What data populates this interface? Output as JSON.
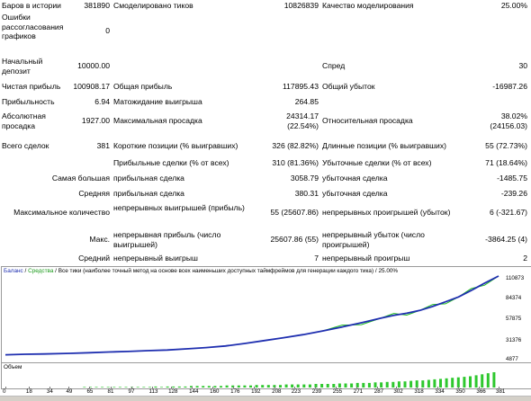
{
  "report": {
    "bars_label": "Баров в истории",
    "bars_value": "381890",
    "ticks_label": "Смоделировано тиков",
    "ticks_value": "10826839",
    "quality_label": "Качество моделирования",
    "quality_value": "25.00%",
    "mismatch_label": "Ошибки рассогласования графиков",
    "mismatch_value": "0",
    "deposit_label": "Начальный депозит",
    "deposit_value": "10000.00",
    "spread_label": "Спред",
    "spread_value": "30",
    "net_label": "Чистая прибыль",
    "net_value": "100908.17",
    "gross_profit_label": "Общая прибыль",
    "gross_profit_value": "117895.43",
    "gross_loss_label": "Общий убыток",
    "gross_loss_value": "-16987.26",
    "pf_label": "Прибыльность",
    "pf_value": "6.94",
    "expected_label": "Матожидание выигрыша",
    "expected_value": "264.85",
    "abs_dd_label": "Абсолютная просадка",
    "abs_dd_value": "1927.00",
    "max_dd_label": "Максимальная просадка",
    "max_dd_value": "24314.17\n(22.54%)",
    "rel_dd_label": "Относительная просадка",
    "rel_dd_value": "38.02%\n(24156.03)",
    "total_label": "Всего сделок",
    "total_value": "381",
    "short_label": "Короткие позиции (% выигравших)",
    "short_value": "326 (82.82%)",
    "long_label": "Длинные позиции (% выигравших)",
    "long_value": "55 (72.73%)",
    "profit_trades_label": "Прибыльные сделки (% от всех)",
    "profit_trades_value": "310 (81.36%)",
    "loss_trades_label": "Убыточные сделки (% от всех)",
    "loss_trades_value": "71 (18.64%)",
    "largest_label": "Самая большая",
    "largest_profit_label": "прибыльная сделка",
    "largest_profit_value": "3058.79",
    "largest_loss_label": "убыточная сделка",
    "largest_loss_value": "-1485.75",
    "average_label": "Средняя",
    "average_profit_label": "прибыльная сделка",
    "average_profit_value": "380.31",
    "average_loss_label": "убыточная сделка",
    "average_loss_value": "-239.26",
    "maxcount_label": "Максимальное количество",
    "cons_wins_label": "непрерывных выигрышей (прибыль)",
    "cons_wins_value": "55 (25607.86)",
    "cons_losses_label": "непрерывных проигрышей (убыток)",
    "cons_losses_value": "6 (-321.67)",
    "max_label": "Макс.",
    "cons_profit_label": "непрерывная прибыль (число выигрышей)",
    "cons_profit_value": "25607.86 (55)",
    "cons_loss_label": "непрерывный убыток (число проигрышей)",
    "cons_loss_value": "-3864.25 (4)",
    "avg2_label": "Средний",
    "avg_cons_wins_label": "непрерывный выигрыш",
    "avg_cons_wins_value": "7",
    "avg_cons_losses_label": "непрерывный проигрыш",
    "avg_cons_losses_value": "2"
  },
  "chart": {
    "legend_balance": "Баланс",
    "legend_sep1": " / ",
    "legend_equity": "Средства",
    "legend_rest": " / Все тики (наиболее точный метод на основе всех наименьших доступных таймфреймов для генерации каждого тика) / 25.00%",
    "volume_label": "Объем",
    "colors": {
      "balance": "#1f2fb0",
      "equity": "#1dbb1d",
      "volume": "#2ec82e"
    }
  },
  "chart_data": {
    "type": "line",
    "title": "",
    "series": [
      {
        "name": "Баланс",
        "x": [
          0,
          15,
          30,
          50,
          65,
          80,
          95,
          110,
          125,
          140,
          155,
          170,
          185,
          200,
          215,
          230,
          245,
          260,
          275,
          290,
          300,
          310,
          320,
          330,
          340,
          350,
          360,
          370,
          381
        ],
        "values": [
          10000,
          10600,
          11000,
          11800,
          12600,
          13500,
          14200,
          15200,
          16000,
          17500,
          19200,
          21200,
          24500,
          28200,
          31800,
          35700,
          40500,
          45500,
          51000,
          56800,
          60500,
          63200,
          66700,
          71800,
          77800,
          84000,
          92500,
          101500,
          110908
        ]
      },
      {
        "name": "Средства",
        "x": [
          0,
          15,
          30,
          50,
          65,
          80,
          95,
          110,
          125,
          140,
          155,
          170,
          185,
          200,
          215,
          230,
          245,
          260,
          275,
          290,
          300,
          310,
          320,
          330,
          340,
          350,
          360,
          370,
          381
        ],
        "values": [
          10000,
          10600,
          11000,
          11800,
          12600,
          13500,
          14200,
          15200,
          16000,
          17500,
          19200,
          21200,
          24500,
          28200,
          31800,
          35700,
          40500,
          45500,
          51000,
          56800,
          60500,
          63200,
          66700,
          71800,
          77800,
          84000,
          92500,
          101500,
          110908
        ]
      }
    ],
    "y_ticks": [
      "110873",
      "84374",
      "57875",
      "31376",
      "4877"
    ],
    "ylim": [
      4877,
      110873
    ],
    "x_ticks": [
      "0",
      "18",
      "34",
      "49",
      "65",
      "81",
      "97",
      "113",
      "128",
      "144",
      "160",
      "176",
      "192",
      "208",
      "223",
      "239",
      "255",
      "271",
      "287",
      "302",
      "318",
      "334",
      "350",
      "366",
      "381"
    ],
    "xlim": [
      0,
      381
    ],
    "volume": [
      1,
      1,
      1,
      1,
      1,
      1,
      1,
      1,
      1,
      1,
      1,
      1,
      2,
      1,
      2,
      2,
      2,
      2,
      3,
      3,
      3,
      3,
      3,
      3,
      4,
      4,
      4,
      4,
      4,
      5,
      5,
      5,
      5,
      5,
      6,
      6,
      6,
      6,
      6,
      7,
      7,
      7,
      7,
      8,
      8,
      8,
      9,
      9,
      9,
      10,
      10,
      11,
      11,
      12,
      12,
      13,
      14,
      14,
      15,
      16,
      17,
      18,
      19,
      20,
      21,
      22,
      24,
      26,
      28,
      30
    ]
  }
}
